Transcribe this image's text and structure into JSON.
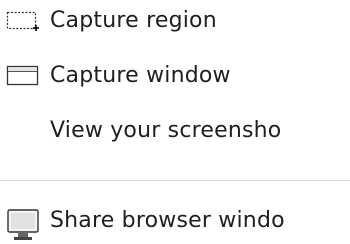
{
  "menu": {
    "items": [
      {
        "label": "Capture region",
        "icon": "capture-region-icon"
      },
      {
        "label": "Capture window",
        "icon": "capture-window-icon"
      },
      {
        "label": "View your screensho",
        "icon": ""
      },
      {
        "label": "Share browser windo",
        "icon": "monitor-icon"
      }
    ]
  },
  "colors": {
    "text": "#1f1f1f",
    "divider": "#dcdcdc",
    "icon_stroke": "#333333",
    "icon_fill": "#e9e9e9"
  }
}
